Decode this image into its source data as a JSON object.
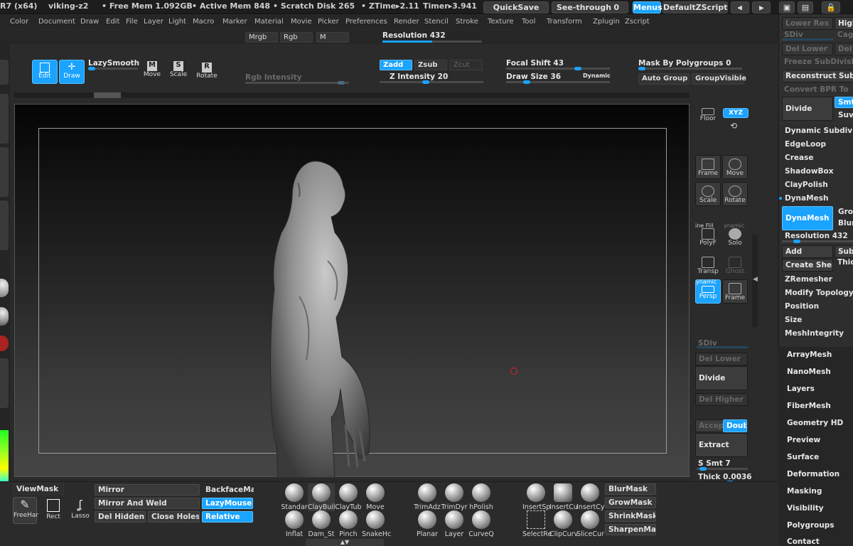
{
  "titlebar": {
    "app": "R7 (x64)",
    "doc": "viking-z2",
    "free_mem": "• Free Mem 1.092GB",
    "active_mem": "• Active Mem 848",
    "scratch": "• Scratch Disk 265",
    "ztime": "• ZTime▸2.11",
    "timer": "Timer▸3.941",
    "quicksave": "QuickSave",
    "seethrough": "See-through",
    "seethrough_val": "0",
    "menus": "Menus",
    "defaultzscript": "DefaultZScript"
  },
  "menubar": [
    "Color",
    "Document",
    "Draw",
    "Edit",
    "File",
    "Layer",
    "Light",
    "Macro",
    "Marker",
    "Material",
    "Movie",
    "Picker",
    "Preferences",
    "Render",
    "Stencil",
    "Stroke",
    "Texture",
    "Tool",
    "Transform",
    "Zplugin",
    "Zscript"
  ],
  "row2": {
    "mrgb": "Mrgb",
    "rgb": "Rgb",
    "m": "M",
    "resolution": "Resolution 432"
  },
  "toolbar": {
    "edit": "Edit",
    "draw": "Draw",
    "lazysmooth": "LazySmooth",
    "move": "Move",
    "scale": "Scale",
    "rotate": "Rotate",
    "rgb_intensity": "Rgb Intensity",
    "zadd": "Zadd",
    "zsub": "Zsub",
    "zcut": "Zcut",
    "z_intensity": "Z Intensity 20",
    "focal_shift": "Focal Shift 43",
    "draw_size": "Draw Size 36",
    "dynamic": "Dynamic",
    "mask_by_polygroups": "Mask By Polygroups 0",
    "auto_groups": "Auto Group",
    "groupvisible": "GroupVisible",
    "m_key": "M",
    "s_key": "S",
    "r_key": "R"
  },
  "rightshelf": {
    "floor": "Floor",
    "xyz": "XYZ",
    "frame": "Frame",
    "move": "Move",
    "scale": "Scale",
    "rotate": "Rotate",
    "polyf": "PolyF",
    "line_fill": "ine Fill",
    "solo": "Solo",
    "dynamic": "ynamic",
    "transp": "Transp",
    "ghost": "Ghost",
    "persp": "Persp",
    "persp_top": "ynamic",
    "frame2": "Frame",
    "sdiv": "SDiv",
    "del_lower": "Del Lower",
    "divide": "Divide",
    "del_higher": "Del Higher",
    "accept": "Accep",
    "double": "Doubl",
    "extract": "Extract",
    "s_smt": "S Smt 7",
    "thick": "Thick 0.0036"
  },
  "bottom": {
    "viewmask": "ViewMask",
    "mirror": "Mirror",
    "mirror_weld": "Mirror And Weld",
    "del_hidden": "Del Hidden",
    "close_holes": "Close Holes",
    "backfacemask": "BackfaceMas",
    "lazymouse": "LazyMouse",
    "relative": "Relative",
    "freehand": "FreeHar",
    "rect": "Rect",
    "lasso": "Lasso",
    "blurmask": "BlurMask",
    "growmask": "GrowMask",
    "shrinkmask": "ShrinkMask",
    "sharpenmask": "SharpenMas"
  },
  "brushes": [
    "Standar",
    "ClayBuil",
    "ClayTub",
    "Move",
    "Inflat",
    "Dam_St",
    "Pinch",
    "SnakeHc",
    "TrimAdz",
    "TrimDyr",
    "hPolish",
    "Planar",
    "Layer",
    "CurveQ",
    "InsertSp",
    "InsertCu",
    "InsertCy",
    "SelectRe",
    "ClipCurv",
    "SliceCur"
  ],
  "panel": {
    "lower_res": "Lower Res",
    "high": "High",
    "sdiv": "SDiv",
    "cage": "Cage",
    "del_lower": "Del Lower",
    "del_h": "Del",
    "freeze_subdiv": "Freeze SubDivision",
    "reconstruct": "Reconstruct Sub",
    "convert_bpr": "Convert BPR To",
    "divide": "Divide",
    "smt": "Smt",
    "suv": "Suv",
    "dynamic_subdiv": "Dynamic Subdiv",
    "edgeloop": "EdgeLoop",
    "crease": "Crease",
    "shadowbox": "ShadowBox",
    "claypolish": "ClayPolish",
    "dynamesh_head": "DynaMesh",
    "dynamesh_btn": "DynaMesh",
    "groups": "Grou",
    "blur": "Blur",
    "resolution": "Resolution 432",
    "add": "Add",
    "sub": "Sub",
    "create_shell": "Create Shell",
    "thick": "Thic",
    "zremesher": "ZRemesher",
    "modify_topology": "Modify Topology",
    "position": "Position",
    "size": "Size",
    "meshintegrity": "MeshIntegrity"
  },
  "palette": [
    "ArrayMesh",
    "NanoMesh",
    "Layers",
    "FiberMesh",
    "Geometry HD",
    "Preview",
    "Surface",
    "Deformation",
    "Masking",
    "Visibility",
    "Polygroups",
    "Contact"
  ]
}
